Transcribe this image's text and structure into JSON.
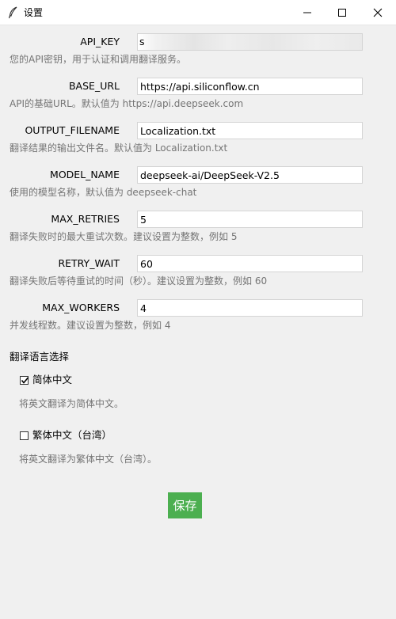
{
  "window": {
    "title": "设置",
    "app_icon": "feather-icon",
    "controls": [
      "minimize-icon",
      "maximize-icon",
      "close-icon"
    ]
  },
  "fields": [
    {
      "key": "api_key",
      "label": "API_KEY",
      "value": "s",
      "masked": true,
      "description": "您的API密钥，用于认证和调用翻译服务。"
    },
    {
      "key": "base_url",
      "label": "BASE_URL",
      "value": "https://api.siliconflow.cn",
      "description": "API的基础URL。默认值为 https://api.deepseek.com"
    },
    {
      "key": "output_filename",
      "label": "OUTPUT_FILENAME",
      "value": "Localization.txt",
      "description": "翻译结果的输出文件名。默认值为 Localization.txt"
    },
    {
      "key": "model_name",
      "label": "MODEL_NAME",
      "value": "deepseek-ai/DeepSeek-V2.5",
      "description": "使用的模型名称，默认值为 deepseek-chat"
    },
    {
      "key": "max_retries",
      "label": "MAX_RETRIES",
      "value": "5",
      "description": "翻译失败时的最大重试次数。建议设置为整数，例如 5"
    },
    {
      "key": "retry_wait",
      "label": "RETRY_WAIT",
      "value": "60",
      "description": "翻译失败后等待重试的时间（秒）。建议设置为整数，例如 60"
    },
    {
      "key": "max_workers",
      "label": "MAX_WORKERS",
      "value": "4",
      "description": "并发线程数。建议设置为整数，例如 4"
    }
  ],
  "languages": {
    "title": "翻译语言选择",
    "items": [
      {
        "label": "简体中文",
        "checked": true,
        "description": "将英文翻译为简体中文。"
      },
      {
        "label": "繁体中文（台湾）",
        "checked": false,
        "description": "将英文翻译为繁体中文（台湾）。"
      }
    ]
  },
  "save_button": {
    "label": "保存",
    "color": "#4caf50"
  },
  "colors": {
    "background": "#f0f0f0",
    "description_text": "#757575"
  }
}
